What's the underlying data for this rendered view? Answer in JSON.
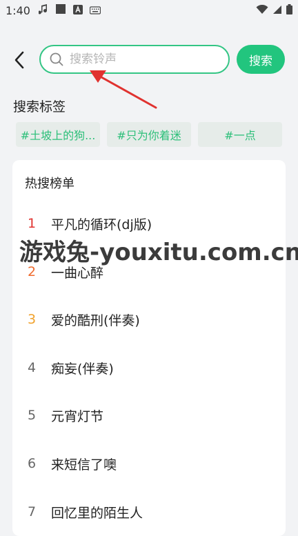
{
  "status_bar": {
    "time": "1:40"
  },
  "search": {
    "placeholder": "搜索铃声",
    "button_label": "搜索"
  },
  "tags": {
    "title": "搜索标签",
    "items": [
      "#土坡上的狗...",
      "#只为你着迷",
      "#一点"
    ]
  },
  "hot_list": {
    "title": "热搜榜单",
    "items": [
      {
        "rank": "1",
        "title": "平凡的循环(dj版)"
      },
      {
        "rank": "2",
        "title": "一曲心醉"
      },
      {
        "rank": "3",
        "title": "爱的酷刑(伴奏)"
      },
      {
        "rank": "4",
        "title": "痴妄(伴奏)"
      },
      {
        "rank": "5",
        "title": "元宵灯节"
      },
      {
        "rank": "6",
        "title": "来短信了噢"
      },
      {
        "rank": "7",
        "title": "回忆里的陌生人"
      }
    ]
  },
  "watermark": "游戏兔-youxitu.com.cn",
  "colors": {
    "accent": "#22c57e",
    "rank_1": "#e0322f",
    "rank_2": "#ef6a2d",
    "rank_3": "#f0a12b",
    "rank_other": "#666666",
    "annotation_arrow": "#e0322f"
  },
  "icons": [
    "music-note-icon",
    "square-icon",
    "text-a-icon",
    "keyboard-icon",
    "wifi-icon",
    "signal-icon",
    "battery-icon",
    "back-arrow-icon",
    "search-icon"
  ]
}
